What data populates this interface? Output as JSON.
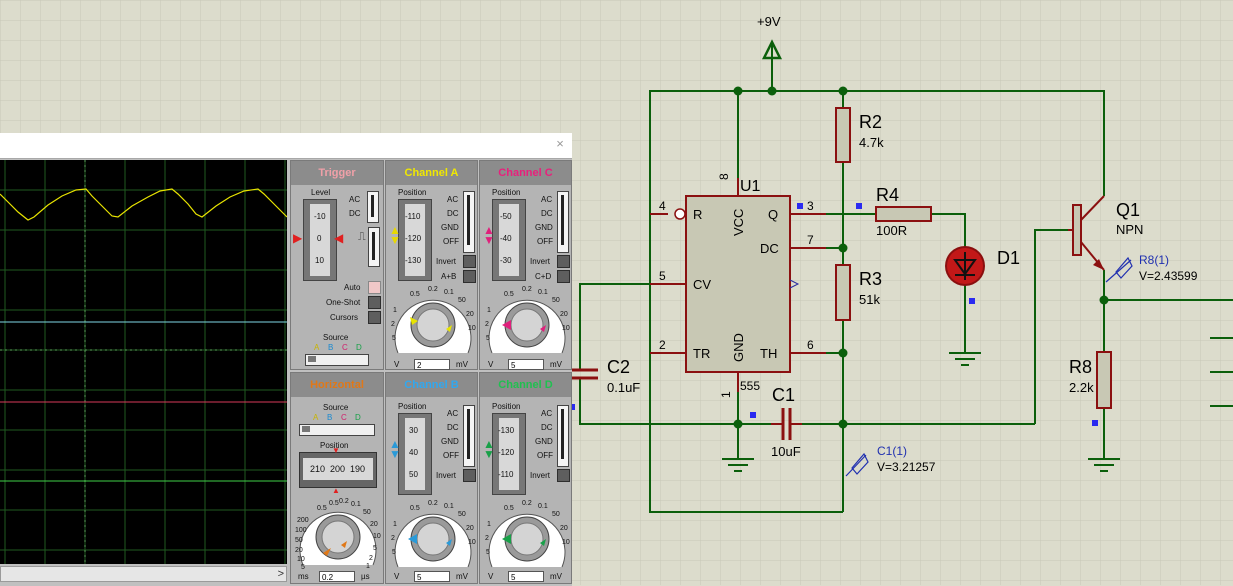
{
  "supply": {
    "label": "+9V"
  },
  "components": {
    "u1": {
      "ref": "U1",
      "type": "555",
      "pins": {
        "reset": "R",
        "vcc": "VCC",
        "q": "Q",
        "dc": "DC",
        "cv": "CV",
        "tr": "TR",
        "gnd": "GND",
        "th": "TH"
      },
      "pin_numbers": {
        "p8": "8",
        "p4": "4",
        "p3": "3",
        "p7": "7",
        "p5": "5",
        "p2": "2",
        "p6": "6",
        "p1": "1"
      }
    },
    "r2": {
      "ref": "R2",
      "value": "4.7k"
    },
    "r3": {
      "ref": "R3",
      "value": "51k"
    },
    "r4": {
      "ref": "R4",
      "value": "100R"
    },
    "r8": {
      "ref": "R8",
      "value": "2.2k"
    },
    "c1": {
      "ref": "C1",
      "value": "10uF"
    },
    "c2": {
      "ref": "C2",
      "value": "0.1uF"
    },
    "d1": {
      "ref": "D1"
    },
    "q1": {
      "ref": "Q1",
      "type": "NPN"
    }
  },
  "probes": {
    "r8": {
      "ref": "R8(1)",
      "reading": "V=2.43599"
    },
    "c1": {
      "ref": "C1(1)",
      "reading": "V=3.21257"
    }
  },
  "oscilloscope": {
    "trigger": {
      "title": "Trigger",
      "level_label": "Level",
      "ac": "AC",
      "dc": "DC",
      "scale": [
        "-10",
        "0",
        "10"
      ],
      "auto": "Auto",
      "one_shot": "One-Shot",
      "cursors": "Cursors",
      "source_label": "Source",
      "sources": [
        "A",
        "B",
        "C",
        "D"
      ]
    },
    "channel_a": {
      "title": "Channel A",
      "position_label": "Position",
      "scale": [
        "-110",
        "-120",
        "-130"
      ],
      "modes": [
        "AC",
        "DC",
        "GND",
        "OFF"
      ],
      "invert": "Invert",
      "combine": "A+B",
      "value": "2",
      "unit": "mV",
      "v": "V",
      "color": "#e8e400"
    },
    "channel_b": {
      "title": "Channel B",
      "position_label": "Position",
      "scale": [
        "30",
        "40",
        "50"
      ],
      "modes": [
        "AC",
        "DC",
        "GND",
        "OFF"
      ],
      "invert": "Invert",
      "value": "5",
      "unit": "mV",
      "v": "V",
      "color": "#2a9ad8"
    },
    "channel_c": {
      "title": "Channel C",
      "position_label": "Position",
      "scale": [
        "-50",
        "-40",
        "-30"
      ],
      "modes": [
        "AC",
        "DC",
        "GND",
        "OFF"
      ],
      "invert": "Invert",
      "combine": "C+D",
      "value": "5",
      "unit": "mV",
      "v": "V",
      "color": "#e0207c"
    },
    "channel_d": {
      "title": "Channel D",
      "position_label": "Position",
      "scale": [
        "-130",
        "-120",
        "-110"
      ],
      "modes": [
        "AC",
        "DC",
        "GND",
        "OFF"
      ],
      "invert": "Invert",
      "value": "5",
      "unit": "mV",
      "v": "V",
      "color": "#1aa04a"
    },
    "horizontal": {
      "title": "Horizontal",
      "source_label": "Source",
      "sources": [
        "A",
        "B",
        "C",
        "D"
      ],
      "position_label": "Position",
      "position_scale": [
        "210",
        "200",
        "190"
      ],
      "value": "0.2",
      "unit": "µs",
      "ms": "ms",
      "color": "#e07818"
    },
    "knob_ticks": [
      "0.5",
      "0.2",
      "0.1",
      "50",
      "20",
      "10",
      "5",
      "2",
      "1"
    ],
    "horiz_ticks": [
      "0.5",
      "0.2",
      "0.1",
      "50",
      "20",
      "10",
      "5",
      "2",
      "1",
      "0.5",
      "200",
      "100",
      "50",
      "20",
      "10",
      "5",
      "2",
      "1"
    ]
  }
}
